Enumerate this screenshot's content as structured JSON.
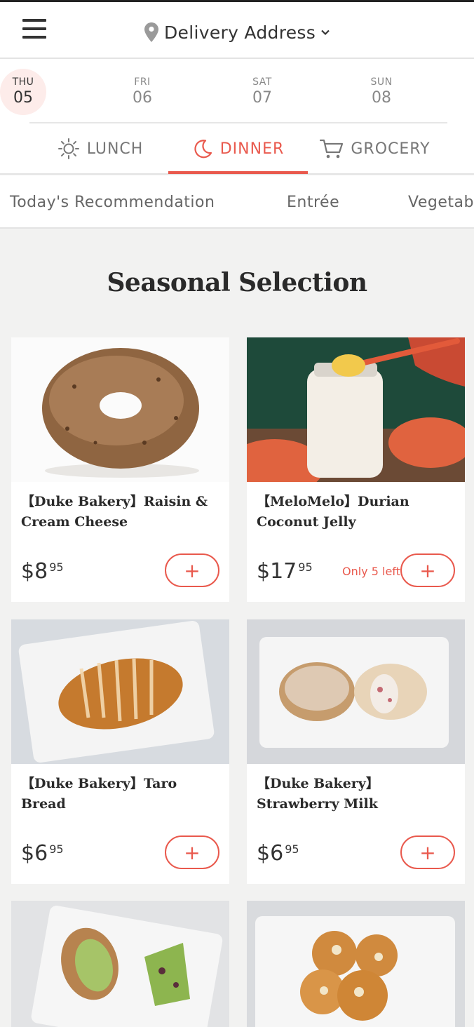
{
  "header": {
    "address_label": "Delivery Address"
  },
  "days": [
    {
      "weekday": "THU",
      "date": "05",
      "selected": true
    },
    {
      "weekday": "FRI",
      "date": "06",
      "selected": false
    },
    {
      "weekday": "SAT",
      "date": "07",
      "selected": false
    },
    {
      "weekday": "SUN",
      "date": "08",
      "selected": false
    }
  ],
  "meals": [
    {
      "label": "LUNCH",
      "icon": "sun-icon",
      "selected": false
    },
    {
      "label": "DINNER",
      "icon": "moon-icon",
      "selected": true
    },
    {
      "label": "GROCERY",
      "icon": "cart-icon",
      "selected": false
    }
  ],
  "categories": [
    "Today's Recommendation",
    "Entrée",
    "Vegetab"
  ],
  "section_title": "Seasonal Selection",
  "products": [
    {
      "name": "【Duke Bakery】Raisin & Cream Cheese",
      "price_main": "$8",
      "price_cents": "95",
      "stock_note": "",
      "image": "raisin-bagel-image"
    },
    {
      "name": "【MeloMelo】Durian Coconut Jelly",
      "price_main": "$17",
      "price_cents": "95",
      "stock_note": "Only 5 left",
      "image": "durian-jelly-jar-image"
    },
    {
      "name": "【Duke Bakery】Taro Bread",
      "price_main": "$6",
      "price_cents": "95",
      "stock_note": "",
      "image": "taro-bread-image"
    },
    {
      "name": "【Duke Bakery】Strawberry Milk",
      "price_main": "$6",
      "price_cents": "95",
      "stock_note": "",
      "image": "strawberry-milk-bread-image"
    },
    {
      "name": "",
      "price_main": "",
      "price_cents": "",
      "stock_note": "",
      "image": "matcha-bread-image"
    },
    {
      "name": "",
      "price_main": "",
      "price_cents": "",
      "stock_note": "",
      "image": "cheese-bun-image"
    }
  ],
  "add_button_symbol": "+",
  "colors": {
    "accent": "#e9594d",
    "selected_day_bg": "#fdecea",
    "page_bg": "#f2f2f1"
  }
}
